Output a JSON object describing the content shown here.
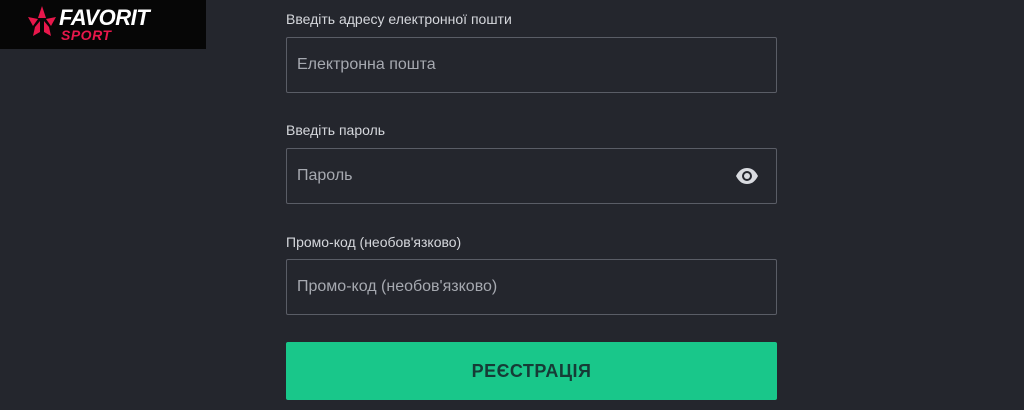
{
  "brand": {
    "name": "FAVORIT",
    "subtitle": "SPORT",
    "accent_color": "#e8174b",
    "logo_icon": "star-icon"
  },
  "form": {
    "email": {
      "label": "Введіть адресу електронної пошти",
      "placeholder": "Електронна пошта",
      "value": ""
    },
    "password": {
      "label": "Введіть пароль",
      "placeholder": "Пароль",
      "value": "",
      "toggle_icon": "eye-icon"
    },
    "promo": {
      "label": "Промо-код (необов'язково)",
      "placeholder": "Промо-код (необов'язково)",
      "value": ""
    },
    "submit_label": "РЕЄСТРАЦІЯ",
    "submit_color": "#19c78a"
  },
  "theme": {
    "background": "#24262d",
    "field_border": "#5a5d66",
    "text": "#d5d7dc"
  }
}
